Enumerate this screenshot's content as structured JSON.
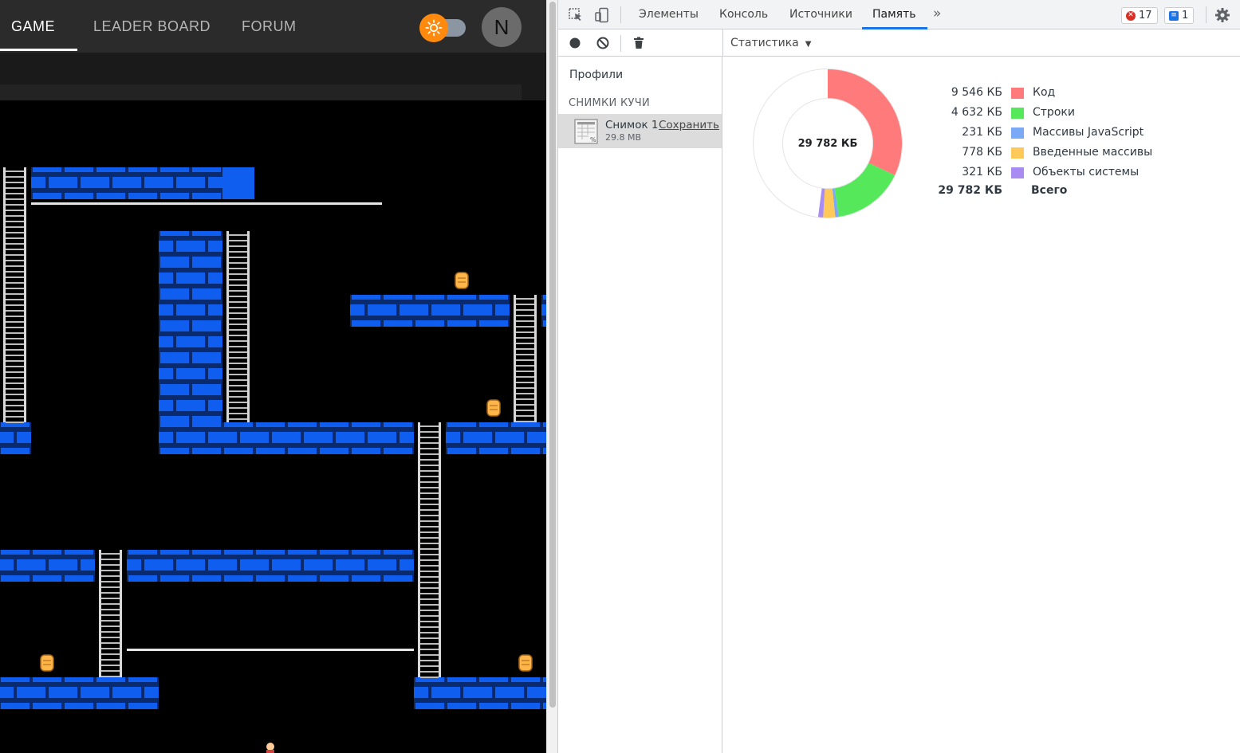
{
  "app": {
    "nav": {
      "tabs": [
        {
          "label": "GAME",
          "active": true
        },
        {
          "label": "LEADER BOARD",
          "active": false
        },
        {
          "label": "FORUM",
          "active": false
        }
      ],
      "avatar_initial": "N"
    },
    "theme_toggle": {
      "icon": "sun-icon",
      "accent": "#ff8a0d"
    },
    "game": {
      "colors": {
        "brick": "#0f5ef0",
        "mortar": "#0a2a6e",
        "ladder": "#d8d8d8",
        "bar": "#e6e6e6",
        "gold": "#ffb547",
        "background": "#000000"
      }
    }
  },
  "devtools": {
    "tabs": [
      {
        "label": "Элементы",
        "active": false
      },
      {
        "label": "Консоль",
        "active": false
      },
      {
        "label": "Источники",
        "active": false
      },
      {
        "label": "Память",
        "active": true
      }
    ],
    "errors_count": "17",
    "messages_count": "1",
    "toolbar": {
      "view_label": "Статистика"
    },
    "sidebar": {
      "profiles_label": "Профили",
      "heap_section_label": "СНИМКИ КУЧИ",
      "snapshot": {
        "name": "Снимок 1",
        "save_label": "Сохранить",
        "size": "29.8 MB"
      }
    },
    "stats": {
      "total_center": "29 782 КБ",
      "legend": [
        {
          "value": "9 546 КБ",
          "label": "Код",
          "color": "#ff7a7a"
        },
        {
          "value": "4 632 КБ",
          "label": "Строки",
          "color": "#55e85a"
        },
        {
          "value": "231 КБ",
          "label": "Массивы JavaScript",
          "color": "#7aa9f5"
        },
        {
          "value": "778 КБ",
          "label": "Введенные массивы",
          "color": "#ffc95a"
        },
        {
          "value": "321 КБ",
          "label": "Объекты системы",
          "color": "#a98cf2"
        }
      ],
      "total_row": {
        "value": "29 782 КБ",
        "label": "Всего"
      },
      "chart_data": {
        "type": "pie",
        "categories": [
          "Код",
          "Строки",
          "Массивы JavaScript",
          "Введенные массивы",
          "Объекты системы"
        ],
        "values": [
          9546,
          4632,
          231,
          778,
          321
        ],
        "total": 29782,
        "unit": "КБ"
      }
    }
  }
}
